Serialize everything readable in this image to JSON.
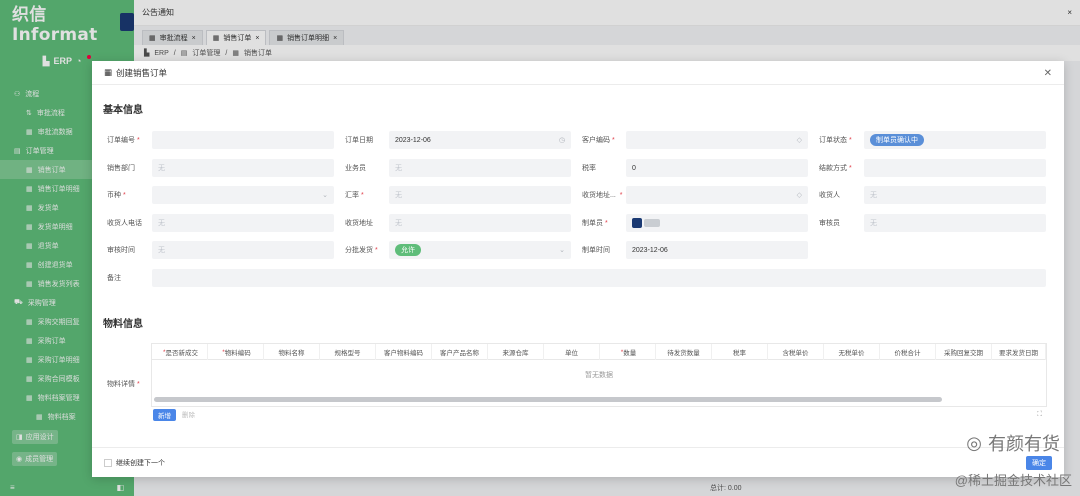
{
  "sidebar": {
    "logo": "织信 Informat",
    "app": "ERP",
    "groups": [
      {
        "label": "流程",
        "items": [
          "审批流程",
          "审批流数据"
        ]
      },
      {
        "label": "订单管理",
        "items": [
          "销售订单",
          "销售订单明细",
          "发货单",
          "发货单明细",
          "退货单",
          "创建退货单",
          "销售发货列表"
        ]
      },
      {
        "label": "采购管理",
        "items": [
          "采购交期回复",
          "采购订单",
          "采购订单明细",
          "采购合同模板",
          "物料档案管理",
          "物料档案"
        ]
      }
    ],
    "btn_design": "应用设计",
    "btn_member": "成员管理",
    "foot_left": "≡",
    "foot_right": "◧"
  },
  "topbar": {
    "title": "公告通知",
    "close": "×"
  },
  "tabs": [
    {
      "label": "审批流程"
    },
    {
      "label": "销售订单"
    },
    {
      "label": "销售订单明细"
    }
  ],
  "breadcrumb": [
    "ERP",
    "订单管理",
    "销售订单"
  ],
  "modal": {
    "title": "创建销售订单",
    "section_basic": "基本信息",
    "section_material": "物料信息",
    "fields": {
      "order_no": "订单编号",
      "order_date": "订单日期",
      "order_date_value": "2023-12-06",
      "customer_code": "客户编码",
      "order_status": "订单状态",
      "order_status_value": "制单员确认中",
      "sales_dept": "销售部门",
      "salesman": "业务员",
      "tax_rate": "税率",
      "tax_rate_value": "0",
      "settle_method": "结款方式",
      "currency": "币种",
      "exchange_rate": "汇率",
      "ship_address": "收货地址...",
      "receiver": "收货人",
      "receiver_phone": "收货人电话",
      "recv_address": "收货地址",
      "maker": "制单员",
      "reviewer": "审核员",
      "review_time": "审核时间",
      "batch_ship": "分批发货",
      "batch_ship_value": "允许",
      "make_time": "制单时间",
      "make_time_value": "2023-12-06",
      "remark": "备注",
      "material_detail": "物料详情",
      "placeholder": "无"
    },
    "table_headers": [
      "是否新成交",
      "物料编码",
      "物料名称",
      "规格型号",
      "客户物料编码",
      "客户产品名称",
      "来源仓库",
      "单位",
      "数量",
      "待发货数量",
      "税率",
      "含税单价",
      "无税单价",
      "价税合计",
      "采购回复交期",
      "要求发货日期"
    ],
    "empty_text": "暂无数据",
    "btn_add": "新增",
    "btn_delete": "删除",
    "continue_label": "继续创建下一个",
    "btn_ok": "确定"
  },
  "bottom_total": "总计: 0.00",
  "watermark": "有颜有货",
  "watermark2": "@稀土掘金技术社区"
}
